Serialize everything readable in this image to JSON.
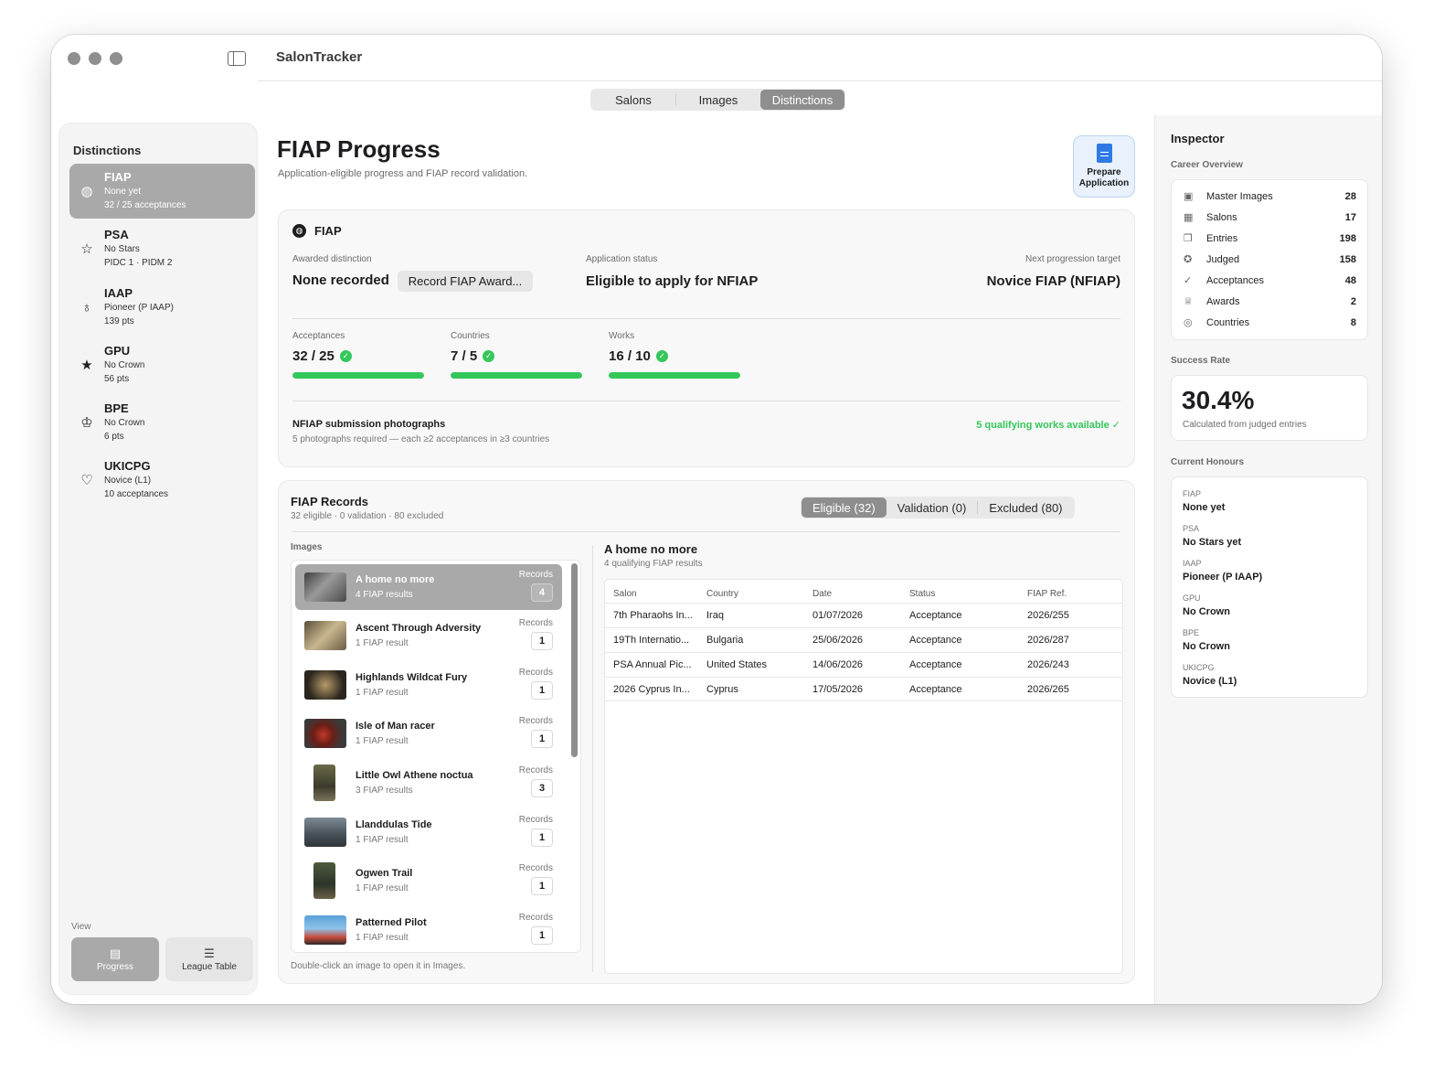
{
  "app": {
    "title": "SalonTracker"
  },
  "top_tabs": [
    "Salons",
    "Images",
    "Distinctions"
  ],
  "top_tab_selected": "Distinctions",
  "sidebar": {
    "title": "Distinctions",
    "items": [
      {
        "name": "FIAP",
        "line1": "None yet",
        "line2": "32 / 25 acceptances",
        "icon": "fiap-globe-icon"
      },
      {
        "name": "PSA",
        "line1": "No Stars",
        "line2": "PIDC 1 · PIDM 2",
        "icon": "star-outline-icon"
      },
      {
        "name": "IAAP",
        "line1": "Pioneer (P IAAP)",
        "line2": "139 pts",
        "icon": "ribbon-icon"
      },
      {
        "name": "GPU",
        "line1": "No Crown",
        "line2": "56 pts",
        "icon": "star-filled-icon"
      },
      {
        "name": "BPE",
        "line1": "No Crown",
        "line2": "6 pts",
        "icon": "crown-icon"
      },
      {
        "name": "UKICPG",
        "line1": "Novice (L1)",
        "line2": "10 acceptances",
        "icon": "shield-icon"
      }
    ],
    "view_label": "View",
    "view_buttons": [
      "Progress",
      "League Table"
    ]
  },
  "main": {
    "title": "FIAP Progress",
    "subtitle": "Application-eligible progress and FIAP record validation.",
    "prepare_button": "Prepare Application",
    "summary": {
      "heading": "FIAP",
      "awarded_label": "Awarded distinction",
      "awarded_value": "None recorded",
      "record_button": "Record FIAP Award...",
      "status_label": "Application status",
      "status_value": "Eligible to apply for NFIAP",
      "target_label": "Next progression target",
      "target_value": "Novice FIAP (NFIAP)",
      "progress": [
        {
          "label": "Acceptances",
          "value": "32 / 25",
          "fraction": 1.0
        },
        {
          "label": "Countries",
          "value": "7 / 5",
          "fraction": 1.0
        },
        {
          "label": "Works",
          "value": "16 / 10",
          "fraction": 1.0
        }
      ],
      "submission_title": "NFIAP submission photographs",
      "submission_desc": "5 photographs required — each ≥2 acceptances in ≥3 countries",
      "qualifying_note": "5 qualifying works available ✓"
    },
    "records": {
      "title": "FIAP Records",
      "subtitle": "32 eligible · 0 validation · 80 excluded",
      "tabs": [
        "Eligible (32)",
        "Validation (0)",
        "Excluded (80)"
      ],
      "images_label": "Images",
      "records_label": "Records",
      "images": [
        {
          "name": "A home no more",
          "sub": "4 FIAP results",
          "count": "4"
        },
        {
          "name": "Ascent Through Adversity",
          "sub": "1 FIAP result",
          "count": "1"
        },
        {
          "name": "Highlands Wildcat Fury",
          "sub": "1 FIAP result",
          "count": "1"
        },
        {
          "name": "Isle of Man racer",
          "sub": "1 FIAP result",
          "count": "1"
        },
        {
          "name": "Little Owl Athene noctua",
          "sub": "3 FIAP results",
          "count": "3"
        },
        {
          "name": "Llanddulas Tide",
          "sub": "1 FIAP result",
          "count": "1"
        },
        {
          "name": "Ogwen Trail",
          "sub": "1 FIAP result",
          "count": "1"
        },
        {
          "name": "Patterned Pilot",
          "sub": "1 FIAP result",
          "count": "1"
        }
      ],
      "hint": "Double-click an image to open it in Images.",
      "detail_title": "A home no more",
      "detail_sub": "4 qualifying FIAP results",
      "columns": [
        "Salon",
        "Country",
        "Date",
        "Status",
        "FIAP Ref."
      ],
      "rows": [
        [
          "7th Pharaohs In...",
          "Iraq",
          "01/07/2026",
          "Acceptance",
          "2026/255"
        ],
        [
          "19Th Internatio...",
          "Bulgaria",
          "25/06/2026",
          "Acceptance",
          "2026/287"
        ],
        [
          "PSA Annual Pic...",
          "United States",
          "14/06/2026",
          "Acceptance",
          "2026/243"
        ],
        [
          "2026 Cyprus In...",
          "Cyprus",
          "17/05/2026",
          "Acceptance",
          "2026/265"
        ]
      ]
    }
  },
  "inspector": {
    "title": "Inspector",
    "overview_label": "Career Overview",
    "overview": [
      {
        "label": "Master Images",
        "value": "28",
        "icon": "photo-icon"
      },
      {
        "label": "Salons",
        "value": "17",
        "icon": "calendar-icon"
      },
      {
        "label": "Entries",
        "value": "198",
        "icon": "stack-icon"
      },
      {
        "label": "Judged",
        "value": "158",
        "icon": "check-seal-icon"
      },
      {
        "label": "Acceptances",
        "value": "48",
        "icon": "check-circle-icon"
      },
      {
        "label": "Awards",
        "value": "2",
        "icon": "trophy-icon"
      },
      {
        "label": "Countries",
        "value": "8",
        "icon": "globe-icon"
      }
    ],
    "success_label": "Success Rate",
    "success_value": "30.4%",
    "success_sub": "Calculated from judged entries",
    "honours_label": "Current Honours",
    "honours": [
      {
        "org": "FIAP",
        "value": "None yet"
      },
      {
        "org": "PSA",
        "value": "No Stars yet"
      },
      {
        "org": "IAAP",
        "value": "Pioneer (P IAAP)"
      },
      {
        "org": "GPU",
        "value": "No Crown"
      },
      {
        "org": "BPE",
        "value": "No Crown"
      },
      {
        "org": "UKICPG",
        "value": "Novice (L1)"
      }
    ]
  },
  "colors": {
    "accent_green": "#34c759",
    "selection_gray": "#a9a9a9",
    "doc_blue": "#2f7ae5"
  }
}
